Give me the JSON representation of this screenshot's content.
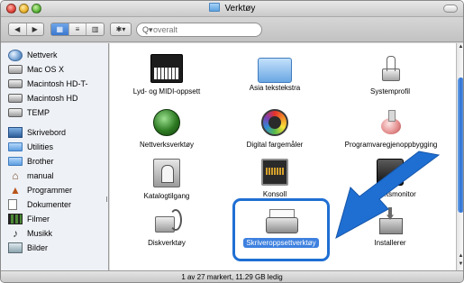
{
  "window": {
    "title": "Verktøy"
  },
  "toolbar": {
    "back_glyph": "◀",
    "forward_glyph": "▶",
    "view_icons_glyph": "▦",
    "view_list_glyph": "≡",
    "view_columns_glyph": "▥",
    "action_glyph": "✱▾",
    "search_placeholder": "overalt",
    "search_icon_glyph": "Q▾"
  },
  "sidebar": {
    "items": [
      {
        "label": "Nettverk",
        "icon": "globe-icon"
      },
      {
        "label": "Mac OS X",
        "icon": "drive-icon"
      },
      {
        "label": "Macintosh HD-T-",
        "icon": "drive-icon"
      },
      {
        "label": "Macintosh HD",
        "icon": "drive-icon"
      },
      {
        "label": "TEMP",
        "icon": "drive-icon"
      },
      {
        "label": "Skrivebord",
        "icon": "desktop-icon"
      },
      {
        "label": "Utilities",
        "icon": "folder-icon"
      },
      {
        "label": "Brother",
        "icon": "folder-icon"
      },
      {
        "label": "manual",
        "icon": "home-icon"
      },
      {
        "label": "Programmer",
        "icon": "applications-icon"
      },
      {
        "label": "Dokumenter",
        "icon": "document-icon"
      },
      {
        "label": "Filmer",
        "icon": "movies-icon"
      },
      {
        "label": "Musikk",
        "icon": "music-icon"
      },
      {
        "label": "Bilder",
        "icon": "pictures-icon"
      }
    ]
  },
  "content": {
    "items": [
      {
        "label": "Lyd- og MIDI-oppsett",
        "icon": "midi-keyboard-icon"
      },
      {
        "label": "Asia tekstekstra",
        "icon": "folder-icon"
      },
      {
        "label": "Systemprofil",
        "icon": "system-profiler-icon"
      },
      {
        "label": "Nettverksverktøy",
        "icon": "network-utility-icon"
      },
      {
        "label": "Digital fargemåler",
        "icon": "color-meter-icon"
      },
      {
        "label": "Programvaregjenoppbygging",
        "icon": "jar-icon"
      },
      {
        "label": "Katalogtilgang",
        "icon": "directory-access-icon"
      },
      {
        "label": "Konsoll",
        "icon": "console-icon"
      },
      {
        "label": "Aktivitetsmonitor",
        "visible_label": "...tsmonitor",
        "icon": "activity-monitor-icon"
      },
      {
        "label": "Diskverktøy",
        "icon": "disk-utility-icon"
      },
      {
        "label": "Skriveroppsettverktøy",
        "icon": "printer-setup-icon",
        "selected": true
      },
      {
        "label": "Installerer",
        "icon": "installer-icon"
      }
    ]
  },
  "status": {
    "text": "1 av 27 markert, 11.29 GB ledig"
  },
  "colors": {
    "highlight": "#1f6fd3",
    "selection": "#3d80df",
    "arrow": "#1f6fd3"
  }
}
